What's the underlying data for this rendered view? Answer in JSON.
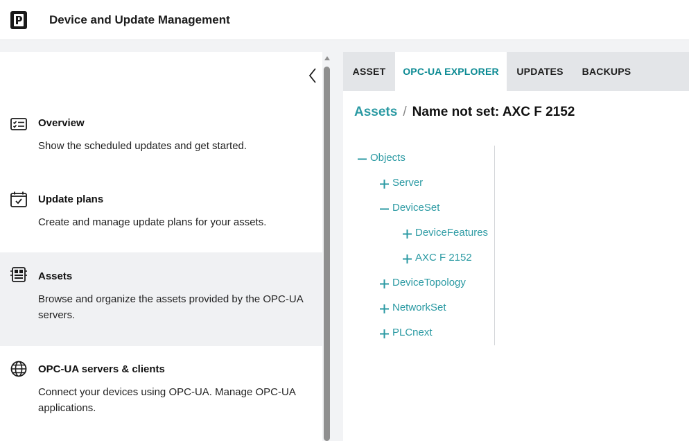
{
  "app": {
    "title": "Device and Update Management"
  },
  "sidebar": {
    "items": [
      {
        "title": "Overview",
        "description": "Show the scheduled updates and get started."
      },
      {
        "title": "Update plans",
        "description": "Create and manage update plans for your assets."
      },
      {
        "title": "Assets",
        "description": "Browse and organize the assets provided by the OPC-UA servers."
      },
      {
        "title": "OPC-UA servers & clients",
        "description": "Connect your devices using OPC-UA. Manage OPC-UA applications."
      }
    ]
  },
  "tabs": [
    "ASSET",
    "OPC-UA EXPLORER",
    "UPDATES",
    "BACKUPS"
  ],
  "breadcrumb": {
    "root": "Assets",
    "separator": "/",
    "current": "Name not set: AXC F 2152"
  },
  "tree": [
    {
      "label": "Objects",
      "toggle": "minus"
    },
    {
      "label": "Server",
      "toggle": "plus"
    },
    {
      "label": "DeviceSet",
      "toggle": "minus"
    },
    {
      "label": "DeviceFeatures",
      "toggle": "plus"
    },
    {
      "label": "AXC F 2152",
      "toggle": "plus"
    },
    {
      "label": "DeviceTopology",
      "toggle": "plus"
    },
    {
      "label": "NetworkSet",
      "toggle": "plus"
    },
    {
      "label": "PLCnext",
      "toggle": "plus"
    }
  ],
  "colors": {
    "accent": "#2b9aa3",
    "active_tab": "#0b8a93",
    "tab_bar": "#e3e5e8",
    "active_nav": "#f0f1f3"
  }
}
